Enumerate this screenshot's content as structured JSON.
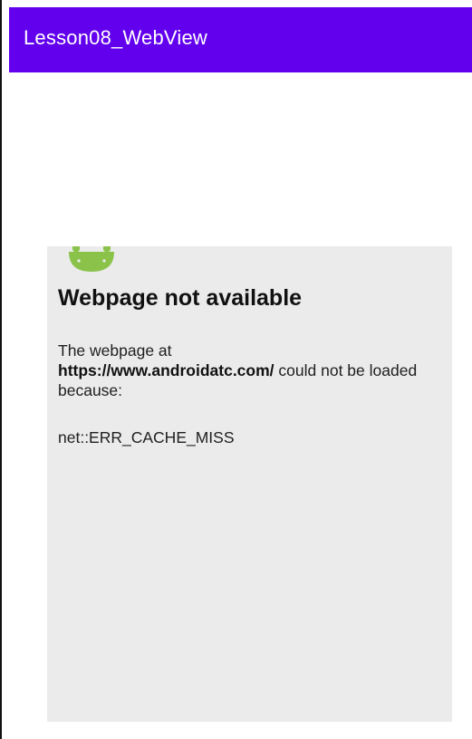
{
  "app_bar": {
    "title": "Lesson08_WebView",
    "color": "#6200ee"
  },
  "webview": {
    "background": "#ebebeb",
    "icon": "android-robot-icon",
    "icon_color": "#8bc34a",
    "error_title": "Webpage not available",
    "message_prefix": "The webpage at",
    "url": "https://www.androidatc.com/",
    "message_suffix": "could not be loaded because:",
    "error_code": "net::ERR_CACHE_MISS"
  }
}
